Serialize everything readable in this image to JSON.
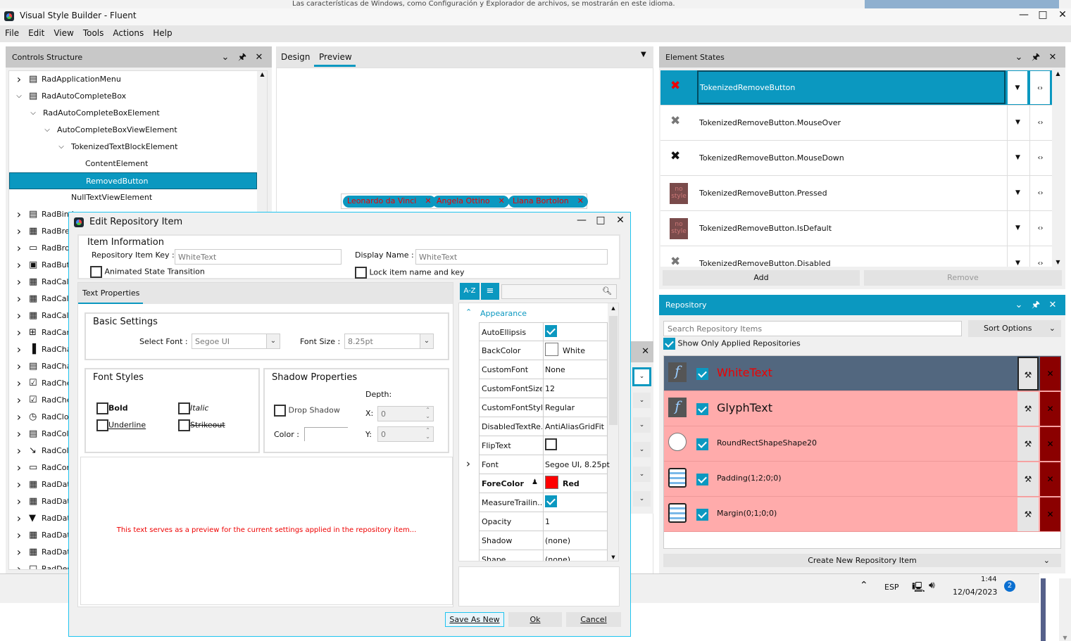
{
  "background_window": {
    "text": "Las características de Windows, como Configuración y Explorador de archivos, se mostrarán en este idioma."
  },
  "window": {
    "title": "Visual Style Builder - Fluent",
    "minimize": "—",
    "maximize": "□",
    "close": "✕"
  },
  "menu": [
    "File",
    "Edit",
    "View",
    "Tools",
    "Actions",
    "Help"
  ],
  "controls_structure": {
    "title": "Controls Structure",
    "tree": [
      {
        "label": "RadApplicationMenu",
        "level": 0,
        "expand": "collapsed"
      },
      {
        "label": "RadAutoCompleteBox",
        "level": 0,
        "expand": "expanded"
      },
      {
        "label": "RadAutoCompleteBoxElement",
        "level": 1,
        "expand": "expanded"
      },
      {
        "label": "AutoCompleteBoxViewElement",
        "level": 2,
        "expand": "expanded"
      },
      {
        "label": "TokenizedTextBlockElement",
        "level": 3,
        "expand": "expanded"
      },
      {
        "label": "ContentElement",
        "level": 4,
        "expand": "none"
      },
      {
        "label": "RemovedButton",
        "level": 4,
        "expand": "none",
        "selected": true
      },
      {
        "label": "NullTextViewElement",
        "level": 3,
        "expand": "none"
      },
      {
        "label": "RadBind",
        "level": 0,
        "expand": "collapsed"
      },
      {
        "label": "RadBre",
        "level": 0,
        "expand": "collapsed"
      },
      {
        "label": "RadBro",
        "level": 0,
        "expand": "collapsed"
      },
      {
        "label": "RadBut",
        "level": 0,
        "expand": "collapsed"
      },
      {
        "label": "RadCal",
        "level": 0,
        "expand": "collapsed"
      },
      {
        "label": "RadCal",
        "level": 0,
        "expand": "collapsed"
      },
      {
        "label": "RadCal",
        "level": 0,
        "expand": "collapsed"
      },
      {
        "label": "RadCar",
        "level": 0,
        "expand": "collapsed"
      },
      {
        "label": "RadCha",
        "level": 0,
        "expand": "collapsed"
      },
      {
        "label": "RadCha",
        "level": 0,
        "expand": "collapsed"
      },
      {
        "label": "RadChe",
        "level": 0,
        "expand": "collapsed"
      },
      {
        "label": "RadChe",
        "level": 0,
        "expand": "collapsed"
      },
      {
        "label": "RadClo",
        "level": 0,
        "expand": "collapsed"
      },
      {
        "label": "RadCol",
        "level": 0,
        "expand": "collapsed"
      },
      {
        "label": "RadCol",
        "level": 0,
        "expand": "collapsed"
      },
      {
        "label": "RadCor",
        "level": 0,
        "expand": "collapsed"
      },
      {
        "label": "RadDat",
        "level": 0,
        "expand": "collapsed"
      },
      {
        "label": "RadDat",
        "level": 0,
        "expand": "collapsed"
      },
      {
        "label": "RadDat",
        "level": 0,
        "expand": "collapsed"
      },
      {
        "label": "RadDat",
        "level": 0,
        "expand": "collapsed"
      },
      {
        "label": "RadDat",
        "level": 0,
        "expand": "collapsed"
      },
      {
        "label": "RadDes",
        "level": 0,
        "expand": "collapsed"
      }
    ]
  },
  "center": {
    "tabs": [
      {
        "label": "Design"
      },
      {
        "label": "Preview",
        "active": true
      }
    ],
    "chips": [
      {
        "label": "Leonardo da Vinci"
      },
      {
        "label": "Angela Ottino"
      },
      {
        "label": "Liana Bortolon"
      }
    ],
    "chip_remove": "✕"
  },
  "element_states": {
    "title": "Element States",
    "states": [
      {
        "label": "TokenizedRemoveButton",
        "icon": "red-x",
        "selected": true
      },
      {
        "label": "TokenizedRemoveButton.MouseOver",
        "icon": "grey-x"
      },
      {
        "label": "TokenizedRemoveButton.MouseDown",
        "icon": "black-x"
      },
      {
        "label": "TokenizedRemoveButton.Pressed",
        "icon": "no-style"
      },
      {
        "label": "TokenizedRemoveButton.IsDefault",
        "icon": "no-style"
      },
      {
        "label": "TokenizedRemoveButton.Disabled",
        "icon": "grey-x"
      }
    ],
    "no_style_text": "no style",
    "add_label": "Add",
    "remove_label": "Remove"
  },
  "repository": {
    "title": "Repository",
    "search_placeholder": "Search Repository Items",
    "sort_label": "Sort Options",
    "show_only_applied": "Show Only Applied Repositories",
    "items": [
      {
        "name": "WhiteText",
        "icon": "font",
        "selected": true,
        "big": true
      },
      {
        "name": "GlyphText",
        "icon": "font",
        "big": true
      },
      {
        "name": "RoundRectShapeShape20",
        "icon": "shape"
      },
      {
        "name": "Padding(1;2;0;0)",
        "icon": "layout"
      },
      {
        "name": "Margin(0;1;0;0)",
        "icon": "layout"
      }
    ],
    "create_label": "Create New Repository Item",
    "colors": {
      "row": "#ffabab",
      "selected_row": "#52677f",
      "remove": "#8b0000"
    }
  },
  "dialog": {
    "title": "Edit Repository Item",
    "item_info": {
      "title": "Item Information",
      "key_label": "Repository Item Key :",
      "key_value": "WhiteText",
      "display_label": "Display Name :",
      "display_value": "WhiteText",
      "animated_label": "Animated State Transition",
      "lock_label": "Lock item name and key"
    },
    "tab": "Text Properties",
    "basic": {
      "title": "Basic Settings",
      "font_label": "Select Font :",
      "font_value": "Segoe UI",
      "size_label": "Font Size :",
      "size_value": "8.25pt"
    },
    "font_styles": {
      "title": "Font Styles",
      "bold": "Bold",
      "italic": "Italic",
      "underline": "Underline",
      "strikeout": "Strikeout"
    },
    "shadow": {
      "title": "Shadow Properties",
      "depth_label": "Depth:",
      "drop_label": "Drop Shadow",
      "color_label": "Color :",
      "x_label": "X:",
      "x_value": "0",
      "y_label": "Y:",
      "y_value": "0"
    },
    "preview_text": "This text serves as a preview for the current settings applied in the repository item...",
    "grid": {
      "az_label": "A-Z",
      "category": "Appearance",
      "rows": [
        {
          "name": "AutoEllipsis",
          "type": "check",
          "value": true
        },
        {
          "name": "BackColor",
          "type": "color",
          "color": "#ffffff",
          "value": "White"
        },
        {
          "name": "CustomFont",
          "value": "None"
        },
        {
          "name": "CustomFontSize",
          "value": "12"
        },
        {
          "name": "CustomFontStyle",
          "value": "Regular"
        },
        {
          "name": "DisabledTextRe...",
          "value": "AntiAliasGridFit"
        },
        {
          "name": "FlipText",
          "type": "check",
          "value": false
        },
        {
          "name": "Font",
          "value": "Segoe UI, 8.25pt",
          "expandable": true
        },
        {
          "name": "ForeColor",
          "type": "color",
          "color": "#ff0000",
          "value": "Red",
          "bold": true
        },
        {
          "name": "MeasureTrailin...",
          "type": "check",
          "value": true
        },
        {
          "name": "Opacity",
          "value": "1"
        },
        {
          "name": "Shadow",
          "value": "(none)"
        },
        {
          "name": "Shape",
          "value": "(none)"
        }
      ]
    },
    "buttons": {
      "save_as_new": "Save As New",
      "ok": "Ok",
      "cancel": "Cancel"
    }
  },
  "taskbar": {
    "language": "ESP",
    "time": "1:44",
    "date": "12/04/2023",
    "notifications": "2"
  },
  "accent": "#0b98c0"
}
